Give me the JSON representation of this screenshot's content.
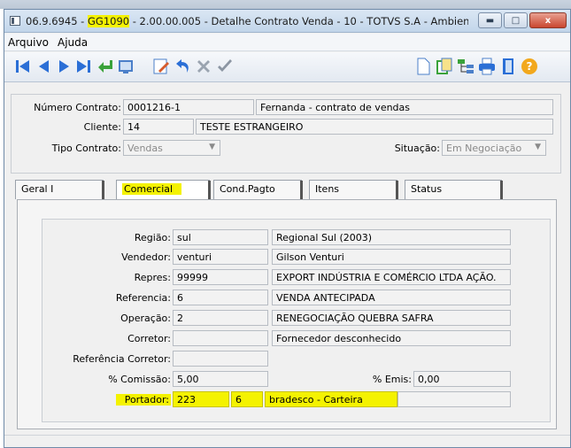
{
  "window": {
    "title_prefix": "06.9.6945 - ",
    "title_highlight": "GG1090",
    "title_suffix": " - 2.00.00.005 - Detalhe Contrato Venda - 10 - TOTVS S.A - Ambiente de D...",
    "controls": {
      "minimize": "▬",
      "maximize": "□",
      "close": "x"
    }
  },
  "menu": {
    "items": [
      "Arquivo",
      "Ajuda"
    ]
  },
  "toolbar": {
    "left_icons": [
      "first-record-icon",
      "previous-record-icon",
      "next-record-icon",
      "last-record-icon",
      "go-to-icon",
      "search-icon",
      "edit-icon",
      "undo-icon",
      "delete-icon",
      "confirm-icon"
    ],
    "right_icons": [
      "new-document-icon",
      "copy-icon",
      "tree-icon",
      "print-icon",
      "exit-icon",
      "help-icon"
    ]
  },
  "header": {
    "numero_contrato": {
      "label": "Número Contrato:",
      "value": "0001216-1",
      "description": "Fernanda - contrato de vendas"
    },
    "cliente": {
      "label": "Cliente:",
      "value": "14",
      "description": "TESTE ESTRANGEIRO"
    },
    "tipo_contrato": {
      "label": "Tipo Contrato:",
      "value": "Vendas"
    },
    "situacao": {
      "label": "Situação:",
      "value": "Em Negociação"
    }
  },
  "tabs": [
    {
      "label": "Geral I",
      "active": false
    },
    {
      "label": "Comercial",
      "active": true
    },
    {
      "label": "Cond.Pagto",
      "active": false
    },
    {
      "label": "Itens",
      "active": false
    },
    {
      "label": "Status",
      "active": false
    }
  ],
  "comercial": {
    "regiao": {
      "label": "Região:",
      "code": "sul",
      "description": "Regional Sul (2003)"
    },
    "vendedor": {
      "label": "Vendedor:",
      "code": "venturi",
      "description": "Gilson Venturi"
    },
    "repres": {
      "label": "Repres:",
      "code": "99999",
      "description": "EXPORT INDÚSTRIA E COMÉRCIO LTDA AÇÃO."
    },
    "referencia": {
      "label": "Referencia:",
      "code": "6",
      "description": "VENDA ANTECIPADA"
    },
    "operacao": {
      "label": "Operação:",
      "code": "2",
      "description": "RENEGOCIAÇÃO QUEBRA SAFRA"
    },
    "corretor": {
      "label": "Corretor:",
      "code": "",
      "description": "Fornecedor desconhecido"
    },
    "referencia_corretor": {
      "label": "Referência Corretor:",
      "value": ""
    },
    "comissao": {
      "label": "% Comissão:",
      "value": "5,00"
    },
    "emis": {
      "label": "% Emis:",
      "value": "0,00"
    },
    "portador": {
      "label": "Portador:",
      "code": "223",
      "modalidade": "6",
      "description": "bradesco - Carteira"
    }
  },
  "colors": {
    "highlight": "#f4f200",
    "title_bar": "#c2d5ea",
    "close_button": "#c9462e"
  }
}
